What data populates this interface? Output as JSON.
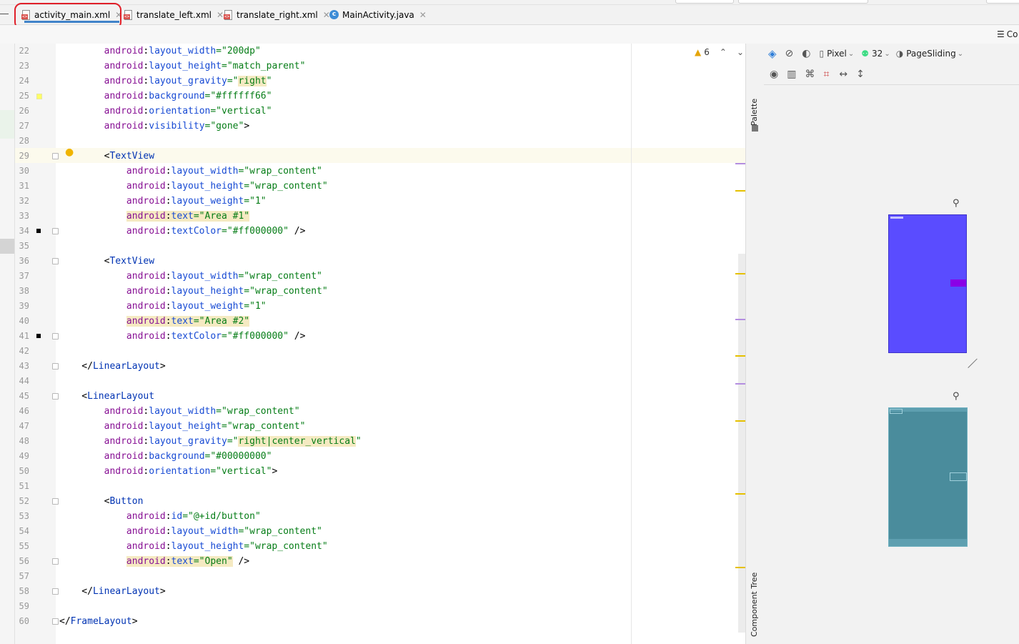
{
  "tabs": [
    {
      "label": "activity_main.xml",
      "icon": "xml-file-icon",
      "active": true
    },
    {
      "label": "translate_left.xml",
      "icon": "xml-file-icon",
      "active": false
    },
    {
      "label": "translate_right.xml",
      "icon": "xml-file-icon",
      "active": false
    },
    {
      "label": "MainActivity.java",
      "icon": "java-class-icon",
      "active": false
    }
  ],
  "subbar": {
    "label": "Co"
  },
  "warnings": {
    "count": "6"
  },
  "lines": [
    {
      "n": "22",
      "code": [
        {
          "t": "        "
        },
        {
          "t": "android",
          "c": "ns"
        },
        {
          "t": ":"
        },
        {
          "t": "layout_width",
          "c": "attr"
        },
        {
          "t": "=\"200dp\"",
          "c": "val"
        }
      ]
    },
    {
      "n": "23",
      "code": [
        {
          "t": "        "
        },
        {
          "t": "android",
          "c": "ns"
        },
        {
          "t": ":"
        },
        {
          "t": "layout_height",
          "c": "attr"
        },
        {
          "t": "=\"match_parent\"",
          "c": "val"
        }
      ]
    },
    {
      "n": "24",
      "code": [
        {
          "t": "        "
        },
        {
          "t": "android",
          "c": "ns"
        },
        {
          "t": ":"
        },
        {
          "t": "layout_gravity",
          "c": "attr"
        },
        {
          "t": "=\"",
          "c": "val"
        },
        {
          "t": "right",
          "c": "val hl"
        },
        {
          "t": "\"",
          "c": "val"
        }
      ]
    },
    {
      "n": "25",
      "code": [
        {
          "t": "        "
        },
        {
          "t": "android",
          "c": "ns"
        },
        {
          "t": ":"
        },
        {
          "t": "background",
          "c": "attr"
        },
        {
          "t": "=\"#ffffff66\"",
          "c": "val"
        }
      ]
    },
    {
      "n": "26",
      "code": [
        {
          "t": "        "
        },
        {
          "t": "android",
          "c": "ns"
        },
        {
          "t": ":"
        },
        {
          "t": "orientation",
          "c": "attr"
        },
        {
          "t": "=\"vertical\"",
          "c": "val"
        }
      ]
    },
    {
      "n": "27",
      "code": [
        {
          "t": "        "
        },
        {
          "t": "android",
          "c": "ns"
        },
        {
          "t": ":"
        },
        {
          "t": "visibility",
          "c": "attr"
        },
        {
          "t": "=\"gone\"",
          "c": "val"
        },
        {
          "t": ">"
        }
      ]
    },
    {
      "n": "28",
      "code": []
    },
    {
      "n": "29",
      "code": [
        {
          "t": "        <"
        },
        {
          "t": "TextView",
          "c": "tag"
        }
      ]
    },
    {
      "n": "30",
      "code": [
        {
          "t": "            "
        },
        {
          "t": "android",
          "c": "ns"
        },
        {
          "t": ":"
        },
        {
          "t": "layout_width",
          "c": "attr"
        },
        {
          "t": "=\"wrap_content\"",
          "c": "val"
        }
      ]
    },
    {
      "n": "31",
      "code": [
        {
          "t": "            "
        },
        {
          "t": "android",
          "c": "ns"
        },
        {
          "t": ":"
        },
        {
          "t": "layout_height",
          "c": "attr"
        },
        {
          "t": "=\"wrap_content\"",
          "c": "val"
        }
      ]
    },
    {
      "n": "32",
      "code": [
        {
          "t": "            "
        },
        {
          "t": "android",
          "c": "ns"
        },
        {
          "t": ":"
        },
        {
          "t": "layout_weight",
          "c": "attr"
        },
        {
          "t": "=\"1\"",
          "c": "val"
        }
      ]
    },
    {
      "n": "33",
      "code": [
        {
          "t": "            "
        },
        {
          "t": "android",
          "c": "ns hl"
        },
        {
          "t": ":",
          "c": "hl"
        },
        {
          "t": "text",
          "c": "attr hl"
        },
        {
          "t": "=\"Area #1\"",
          "c": "val hl"
        }
      ]
    },
    {
      "n": "34",
      "code": [
        {
          "t": "            "
        },
        {
          "t": "android",
          "c": "ns"
        },
        {
          "t": ":"
        },
        {
          "t": "textColor",
          "c": "attr"
        },
        {
          "t": "=\"#ff000000\"",
          "c": "val"
        },
        {
          "t": " />"
        }
      ]
    },
    {
      "n": "35",
      "code": []
    },
    {
      "n": "36",
      "code": [
        {
          "t": "        <"
        },
        {
          "t": "TextView",
          "c": "tag"
        }
      ]
    },
    {
      "n": "37",
      "code": [
        {
          "t": "            "
        },
        {
          "t": "android",
          "c": "ns"
        },
        {
          "t": ":"
        },
        {
          "t": "layout_width",
          "c": "attr"
        },
        {
          "t": "=\"wrap_content\"",
          "c": "val"
        }
      ]
    },
    {
      "n": "38",
      "code": [
        {
          "t": "            "
        },
        {
          "t": "android",
          "c": "ns"
        },
        {
          "t": ":"
        },
        {
          "t": "layout_height",
          "c": "attr"
        },
        {
          "t": "=\"wrap_content\"",
          "c": "val"
        }
      ]
    },
    {
      "n": "39",
      "code": [
        {
          "t": "            "
        },
        {
          "t": "android",
          "c": "ns"
        },
        {
          "t": ":"
        },
        {
          "t": "layout_weight",
          "c": "attr"
        },
        {
          "t": "=\"1\"",
          "c": "val"
        }
      ]
    },
    {
      "n": "40",
      "code": [
        {
          "t": "            "
        },
        {
          "t": "android",
          "c": "ns hl"
        },
        {
          "t": ":",
          "c": "hl"
        },
        {
          "t": "text",
          "c": "attr hl"
        },
        {
          "t": "=\"Area #2\"",
          "c": "val hl"
        }
      ]
    },
    {
      "n": "41",
      "code": [
        {
          "t": "            "
        },
        {
          "t": "android",
          "c": "ns"
        },
        {
          "t": ":"
        },
        {
          "t": "textColor",
          "c": "attr"
        },
        {
          "t": "=\"#ff000000\"",
          "c": "val"
        },
        {
          "t": " />"
        }
      ]
    },
    {
      "n": "42",
      "code": []
    },
    {
      "n": "43",
      "code": [
        {
          "t": "    </"
        },
        {
          "t": "LinearLayout",
          "c": "tag"
        },
        {
          "t": ">"
        }
      ]
    },
    {
      "n": "44",
      "code": []
    },
    {
      "n": "45",
      "code": [
        {
          "t": "    <"
        },
        {
          "t": "LinearLayout",
          "c": "tag"
        }
      ]
    },
    {
      "n": "46",
      "code": [
        {
          "t": "        "
        },
        {
          "t": "android",
          "c": "ns"
        },
        {
          "t": ":"
        },
        {
          "t": "layout_width",
          "c": "attr"
        },
        {
          "t": "=\"wrap_content\"",
          "c": "val"
        }
      ]
    },
    {
      "n": "47",
      "code": [
        {
          "t": "        "
        },
        {
          "t": "android",
          "c": "ns"
        },
        {
          "t": ":"
        },
        {
          "t": "layout_height",
          "c": "attr"
        },
        {
          "t": "=\"wrap_content\"",
          "c": "val"
        }
      ]
    },
    {
      "n": "48",
      "code": [
        {
          "t": "        "
        },
        {
          "t": "android",
          "c": "ns"
        },
        {
          "t": ":"
        },
        {
          "t": "layout_gravity",
          "c": "attr"
        },
        {
          "t": "=\"",
          "c": "val"
        },
        {
          "t": "right|center_vertical",
          "c": "val hl"
        },
        {
          "t": "\"",
          "c": "val"
        }
      ]
    },
    {
      "n": "49",
      "code": [
        {
          "t": "        "
        },
        {
          "t": "android",
          "c": "ns"
        },
        {
          "t": ":"
        },
        {
          "t": "background",
          "c": "attr"
        },
        {
          "t": "=\"#00000000\"",
          "c": "val"
        }
      ]
    },
    {
      "n": "50",
      "code": [
        {
          "t": "        "
        },
        {
          "t": "android",
          "c": "ns"
        },
        {
          "t": ":"
        },
        {
          "t": "orientation",
          "c": "attr"
        },
        {
          "t": "=\"vertical\"",
          "c": "val"
        },
        {
          "t": ">"
        }
      ]
    },
    {
      "n": "51",
      "code": []
    },
    {
      "n": "52",
      "code": [
        {
          "t": "        <"
        },
        {
          "t": "Button",
          "c": "tag"
        }
      ]
    },
    {
      "n": "53",
      "code": [
        {
          "t": "            "
        },
        {
          "t": "android",
          "c": "ns"
        },
        {
          "t": ":"
        },
        {
          "t": "id",
          "c": "attr"
        },
        {
          "t": "=\"@+id/button\"",
          "c": "val"
        }
      ]
    },
    {
      "n": "54",
      "code": [
        {
          "t": "            "
        },
        {
          "t": "android",
          "c": "ns"
        },
        {
          "t": ":"
        },
        {
          "t": "layout_width",
          "c": "attr"
        },
        {
          "t": "=\"wrap_content\"",
          "c": "val"
        }
      ]
    },
    {
      "n": "55",
      "code": [
        {
          "t": "            "
        },
        {
          "t": "android",
          "c": "ns"
        },
        {
          "t": ":"
        },
        {
          "t": "layout_height",
          "c": "attr"
        },
        {
          "t": "=\"wrap_content\"",
          "c": "val"
        }
      ]
    },
    {
      "n": "56",
      "code": [
        {
          "t": "            "
        },
        {
          "t": "android",
          "c": "ns hl"
        },
        {
          "t": ":",
          "c": "hl"
        },
        {
          "t": "text",
          "c": "attr hl"
        },
        {
          "t": "=\"Open\"",
          "c": "val hl"
        },
        {
          "t": " />"
        }
      ]
    },
    {
      "n": "57",
      "code": []
    },
    {
      "n": "58",
      "code": [
        {
          "t": "    </"
        },
        {
          "t": "LinearLayout",
          "c": "tag"
        },
        {
          "t": ">"
        }
      ]
    },
    {
      "n": "59",
      "code": []
    },
    {
      "n": "60",
      "code": [
        {
          "t": "</"
        },
        {
          "t": "FrameLayout",
          "c": "tag"
        },
        {
          "t": ">"
        }
      ]
    }
  ],
  "side_tabs": {
    "palette": "Palette",
    "component_tree": "Component Tree"
  },
  "design_toolbar": {
    "device": "Pixel",
    "api": "32",
    "theme": "PageSliding"
  },
  "colors": {
    "accent": "#4083c9",
    "highlight_circle": "#e0202a",
    "design_preview": "#5a4cff",
    "blueprint_preview": "#4a8c9c"
  }
}
